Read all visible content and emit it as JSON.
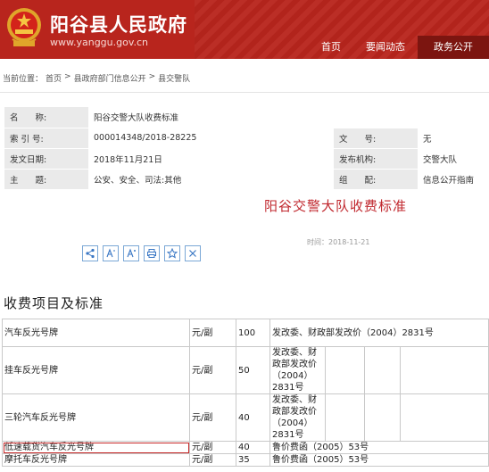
{
  "header": {
    "site_title": "阳谷县人民政府",
    "site_url": "www.yanggu.gov.cn",
    "nav": [
      {
        "label": "首页",
        "active": false
      },
      {
        "label": "要闻动态",
        "active": false
      },
      {
        "label": "政务公开",
        "active": true
      }
    ]
  },
  "breadcrumb": {
    "prefix": "当前位置：",
    "items": [
      "首页",
      ">",
      "县政府部门信息公开",
      ">",
      "县交警队"
    ]
  },
  "meta": {
    "name_label": "名　　称:",
    "name_value": "阳谷交警大队收费标准",
    "index_label": "索 引 号:",
    "index_value": "000014348/2018-28225",
    "doc_no_label": "文　　号:",
    "doc_no_value": "无",
    "date_label": "发文日期:",
    "date_value": "2018年11月21日",
    "org_label": "发布机构:",
    "org_value": "交警大队",
    "topic_label": "主　　题:",
    "topic_value": "公安、安全、司法:其他",
    "category_label": "组　　配:",
    "category_value": "信息公开指南"
  },
  "doc": {
    "title": "阳谷交警大队收费标准",
    "time": "时间：2018-11-21"
  },
  "tools": [
    "share-icon",
    "font-smaller-icon",
    "font-larger-icon",
    "print-icon",
    "favorite-icon",
    "close-icon"
  ],
  "section_title": "收费项目及标准",
  "fee_rows": [
    {
      "name": "汽车反光号牌",
      "unit": "元/副",
      "price": "100",
      "basis": "发改委、财政部发改价（2004）2831号"
    },
    {
      "name": "挂车反光号牌",
      "unit": "元/副",
      "price": "50",
      "basis": "发改委、财政部发改价（2004）2831号"
    },
    {
      "name": "三轮汽车反光号牌",
      "unit": "元/副",
      "price": "40",
      "basis": "发改委、财政部发改价（2004）2831号"
    },
    {
      "name": "低速载货汽车反光号牌",
      "unit": "元/副",
      "price": "40",
      "basis": "鲁价费函（2005）53号"
    },
    {
      "name": "摩托车反光号牌",
      "unit": "元/副",
      "price": "35",
      "basis": "鲁价费函（2005）53号"
    }
  ]
}
